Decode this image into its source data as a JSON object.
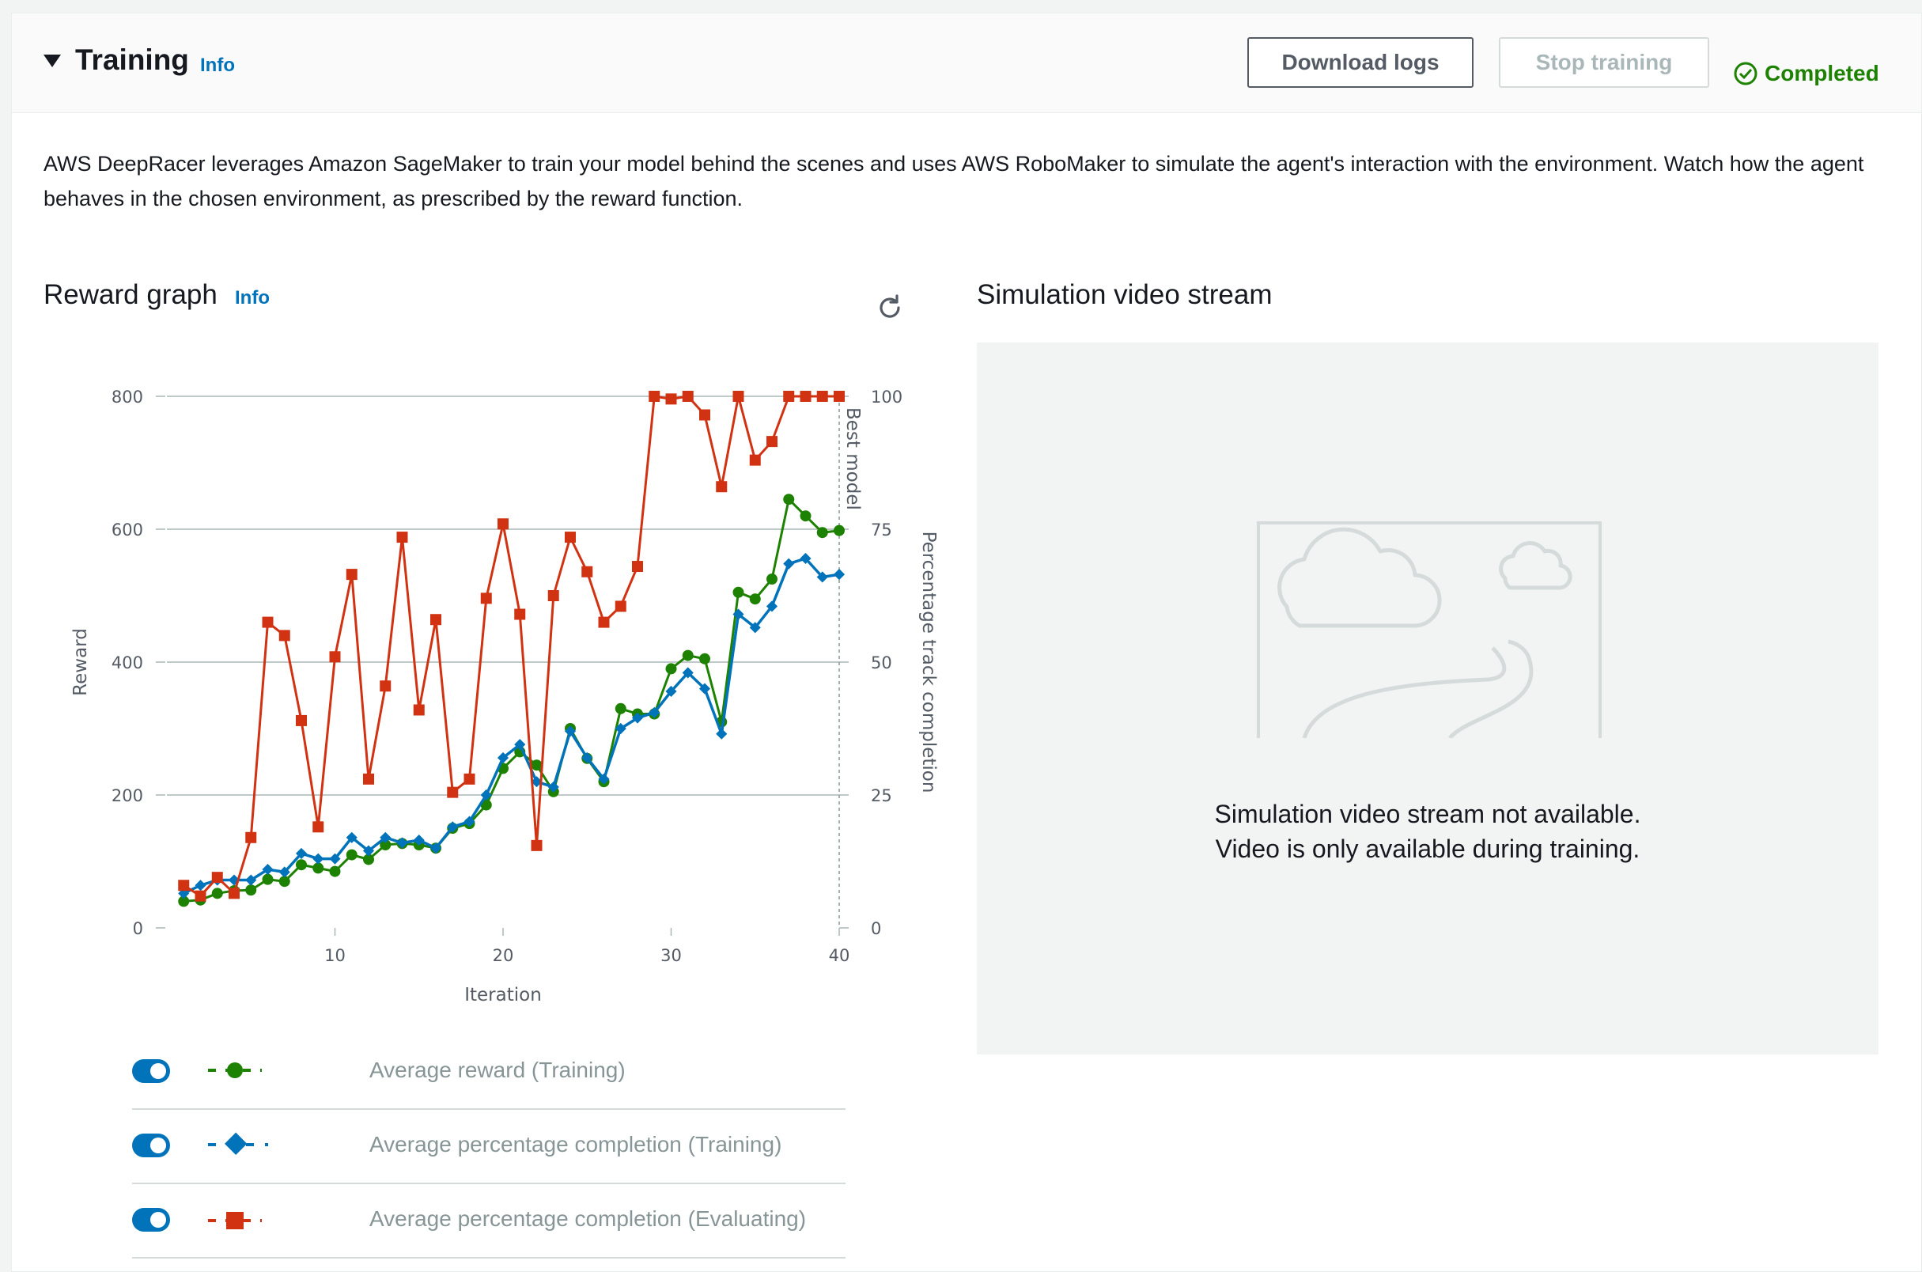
{
  "header": {
    "title": "Training",
    "info": "Info",
    "download_logs": "Download logs",
    "stop_training": "Stop training",
    "status": "Completed"
  },
  "description": "AWS DeepRacer leverages Amazon SageMaker to train your model behind the scenes and uses AWS RoboMaker to simulate the agent's interaction with the environment. Watch how the agent behaves in the chosen environment, as prescribed by the reward function.",
  "reward_graph": {
    "title": "Reward graph",
    "info": "Info"
  },
  "video": {
    "title": "Simulation video stream",
    "line1": "Simulation video stream not available.",
    "line2": "Video is only available during training."
  },
  "legend": [
    {
      "label": "Average reward (Training)",
      "color": "#1d8102",
      "marker": "circle"
    },
    {
      "label": "Average percentage completion (Training)",
      "color": "#0073bb",
      "marker": "diamond"
    },
    {
      "label": "Average percentage completion (Evaluating)",
      "color": "#d13212",
      "marker": "square"
    }
  ],
  "colors": {
    "accent": "#0073bb",
    "success": "#1d8102",
    "reward_training": "#1d8102",
    "completion_training": "#0073bb",
    "completion_evaluating": "#d13212"
  },
  "chart_data": {
    "type": "line",
    "xlabel": "Iteration",
    "ylabel": "Reward",
    "y2label": "Percentage track completion",
    "xlim": [
      0,
      40
    ],
    "ylim": [
      0,
      800
    ],
    "y2lim": [
      0,
      100
    ],
    "x_ticks": [
      10,
      20,
      30,
      40
    ],
    "y_ticks": [
      0,
      200,
      400,
      600,
      800
    ],
    "y2_ticks": [
      0,
      25,
      50,
      75,
      100
    ],
    "grid": true,
    "annotation": "Best model",
    "annotation_x": 40,
    "x": [
      1,
      2,
      3,
      4,
      5,
      6,
      7,
      8,
      9,
      10,
      11,
      12,
      13,
      14,
      15,
      16,
      17,
      18,
      19,
      20,
      21,
      22,
      23,
      24,
      25,
      26,
      27,
      28,
      29,
      30,
      31,
      32,
      33,
      34,
      35,
      36,
      37,
      38,
      39,
      40
    ],
    "series": [
      {
        "name": "Average reward (Training)",
        "axis": "left",
        "values": [
          40,
          42,
          52,
          56,
          57,
          73,
          70,
          95,
          90,
          85,
          110,
          103,
          125,
          127,
          125,
          120,
          150,
          157,
          185,
          240,
          265,
          245,
          205,
          300,
          255,
          220,
          330,
          322,
          322,
          390,
          410,
          405,
          310,
          505,
          495,
          525,
          645,
          620,
          595,
          598
        ]
      },
      {
        "name": "Average percentage completion (Training)",
        "axis": "right",
        "values": [
          6.5,
          8,
          9,
          9,
          9,
          11,
          10.5,
          14,
          13,
          13,
          17,
          14.5,
          17,
          16,
          16.5,
          15,
          19,
          20,
          25,
          32,
          34.5,
          27.5,
          26.5,
          37,
          32,
          28,
          37.5,
          39.5,
          40.5,
          44.5,
          48,
          45,
          36.5,
          59,
          56.5,
          60.5,
          68.5,
          69.5,
          66,
          66.5
        ]
      },
      {
        "name": "Average percentage completion (Evaluating)",
        "axis": "right",
        "values": [
          8,
          6,
          9.5,
          6.5,
          17,
          57.5,
          55,
          39,
          19,
          51,
          66.5,
          28,
          45.5,
          73.5,
          41,
          58,
          25.5,
          28,
          62,
          76,
          59,
          15.5,
          62.5,
          73.5,
          67,
          57.5,
          60.5,
          68,
          100,
          99.5,
          100,
          96.5,
          83,
          100,
          88,
          91.5,
          100,
          100,
          100,
          100
        ]
      }
    ]
  }
}
